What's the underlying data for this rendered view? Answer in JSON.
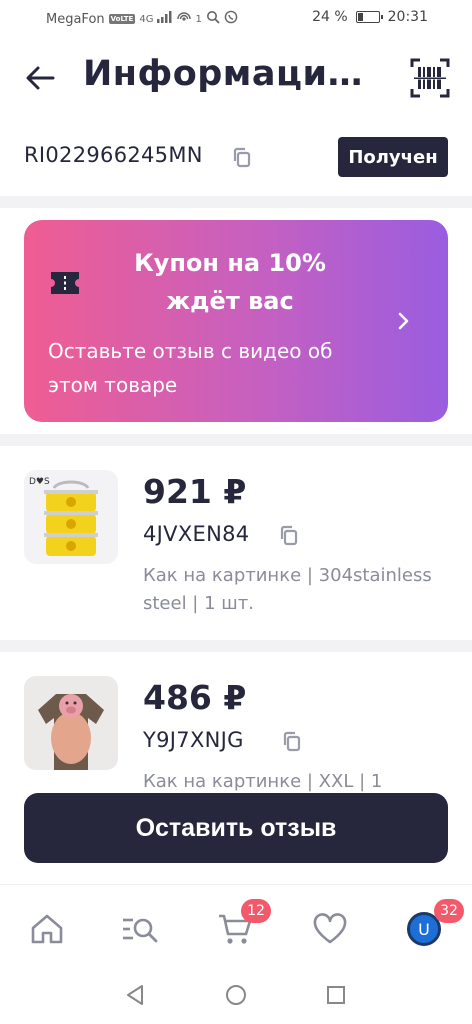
{
  "status_bar": {
    "carrier": "MegaFon",
    "volte_badge": "VoLTE",
    "network": "4G",
    "superscript": "1",
    "battery_text": "24 %",
    "battery_level": 0.24,
    "time": "20:31"
  },
  "header": {
    "title": "Информация о…"
  },
  "tracking": {
    "number": "RI022966245MN",
    "status": "Получен"
  },
  "coupon": {
    "title": "Купон на 10% ждёт вас",
    "subtitle": "Оставьте отзыв с видео об этом товаре"
  },
  "items": [
    {
      "price": "921 ₽",
      "code": "4JVXEN84",
      "attributes": "Как на картинке | 304stainless steel | 1 шт.",
      "thumb_label": "D♥S"
    },
    {
      "price": "486 ₽",
      "code": "Y9J7XNJG",
      "attributes": "Как на картинке | XXL | 1"
    }
  ],
  "actions": {
    "leave_review": "Оставить отзыв"
  },
  "bottom_nav": {
    "cart_badge": "12",
    "profile_badge": "32",
    "avatar_letter": "U"
  },
  "colors": {
    "primary_dark": "#26273d",
    "coupon_gradient_start": "#ef5d92",
    "coupon_gradient_end": "#9a5de0",
    "badge": "#f25a6b"
  }
}
